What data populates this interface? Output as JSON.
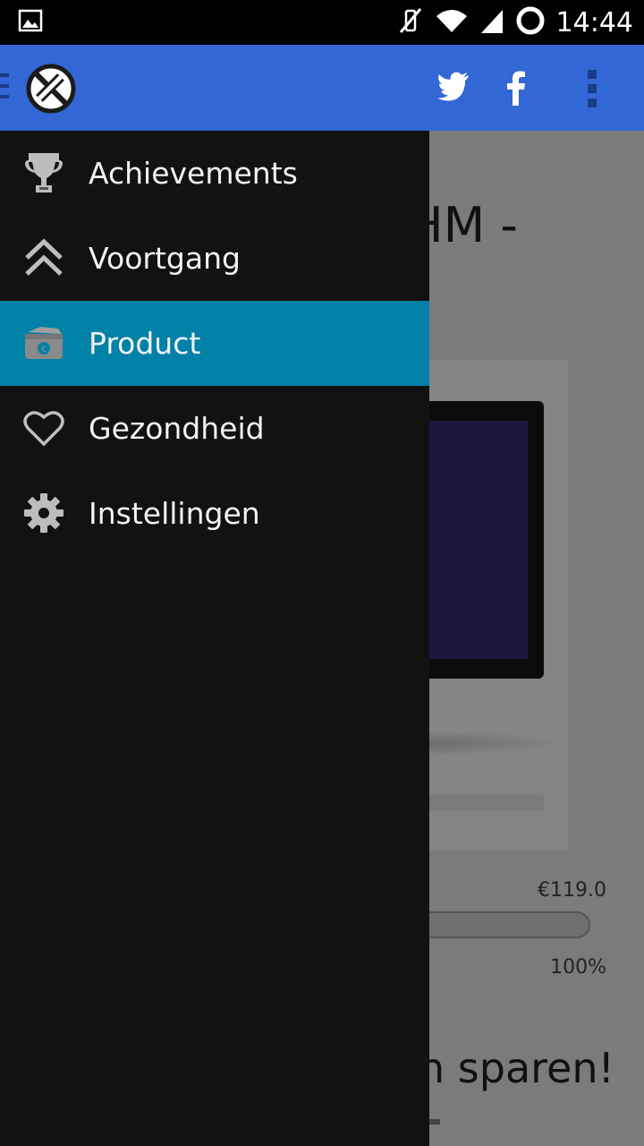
{
  "status_bar": {
    "time": "14:44"
  },
  "action_bar": {
    "logo_icon": "app-logo-icon",
    "actions": [
      {
        "name": "twitter-button",
        "icon": "twitter-icon"
      },
      {
        "name": "facebook-button",
        "icon": "facebook-icon"
      },
      {
        "name": "overflow-menu-button",
        "icon": "more-vert-icon"
      }
    ]
  },
  "drawer": {
    "items": [
      {
        "label": "Achievements",
        "icon": "trophy-icon",
        "active": false
      },
      {
        "label": "Voortgang",
        "icon": "chevrons-up-icon",
        "active": false
      },
      {
        "label": "Product",
        "icon": "wallet-icon",
        "active": true
      },
      {
        "label": "Gezondheid",
        "icon": "heart-icon",
        "active": false
      },
      {
        "label": "Instellingen",
        "icon": "gear-icon",
        "active": false
      }
    ]
  },
  "page": {
    "title_fragment": "HM -",
    "price": "€119.0",
    "progress_percent": "100%",
    "progress_fraction": 1.0,
    "saving_fragment": "n sparen!"
  },
  "colors": {
    "action_bar": "#3367d6",
    "drawer_bg": "#121212",
    "active_item": "#0081a8",
    "status_bar": "#000000"
  }
}
